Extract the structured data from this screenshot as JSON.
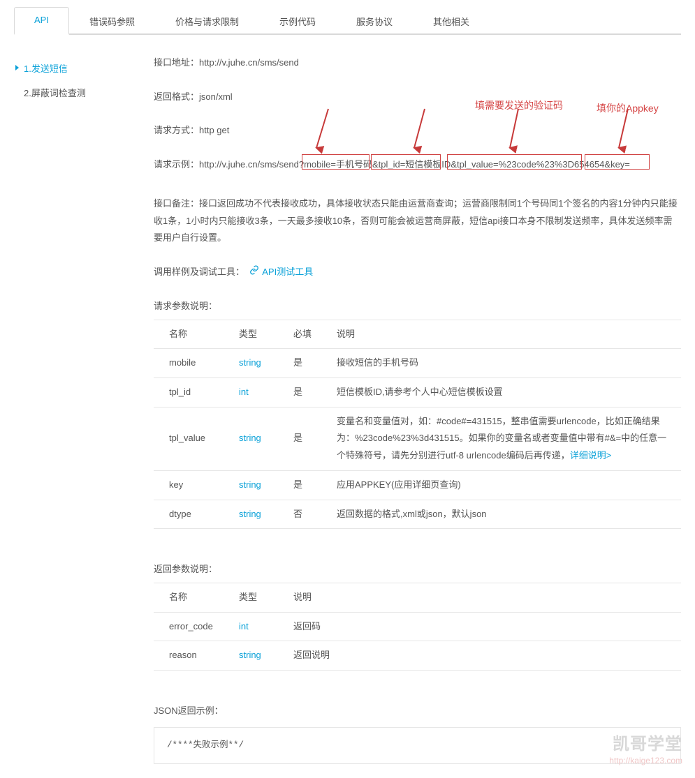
{
  "tabs": [
    "API",
    "错误码参照",
    "价格与请求限制",
    "示例代码",
    "服务协议",
    "其他相关"
  ],
  "sidebar": {
    "items": [
      {
        "label": "1.发送短信"
      },
      {
        "label": "2.屏蔽词检查测"
      }
    ]
  },
  "fields": {
    "addr_label": "接口地址：",
    "addr_value": "http://v.juhe.cn/sms/send",
    "ret_label": "返回格式：",
    "ret_value": "json/xml",
    "method_label": "请求方式：",
    "method_value": "http get",
    "example_label": "请求示例：",
    "example_prefix": "http://v.juhe.cn/sms/send?",
    "example_p1": "mobile=手机号码",
    "example_amp1": "&",
    "example_p2": "tpl_id=短信模板ID",
    "example_amp2": "&",
    "example_p3": "tpl_value=%23code%23%3D654654",
    "example_amp3": "&",
    "example_p4": "key=",
    "remark_label": "接口备注：",
    "remark_value": "接口返回成功不代表接收成功，具体接收状态只能由运营商查询；运营商限制同1个号码同1个签名的内容1分钟内只能接收1条，1小时内只能接收3条，一天最多接收10条，否则可能会被运营商屏蔽，短信api接口本身不限制发送频率，具体发送频率需要用户自行设置。",
    "debug_label": "调用样例及调试工具：",
    "debug_link": "API测试工具",
    "req_params_label": "请求参数说明：",
    "resp_params_label": "返回参数说明：",
    "json_example_label": "JSON返回示例：",
    "code_block": "/****失败示例**/"
  },
  "hints": {
    "h1": "填需要发送的验证码",
    "h2": "填你的Appkey"
  },
  "req_table": {
    "headers": [
      "名称",
      "类型",
      "必填",
      "说明"
    ],
    "rows": [
      {
        "name": "mobile",
        "type": "string",
        "req": "是",
        "desc": "接收短信的手机号码"
      },
      {
        "name": "tpl_id",
        "type": "int",
        "req": "是",
        "desc": "短信模板ID,请参考个人中心短信模板设置"
      },
      {
        "name": "tpl_value",
        "type": "string",
        "req": "是",
        "desc": "变量名和变量值对，如：#code#=431515，整串值需要urlencode，比如正确结果为：%23code%23%3d431515。如果你的变量名或者变量值中带有#&=中的任意一个特殊符号，请先分别进行utf-8 urlencode编码后再传递，",
        "link": "详细说明>"
      },
      {
        "name": "key",
        "type": "string",
        "req": "是",
        "desc": "应用APPKEY(应用详细页查询)"
      },
      {
        "name": "dtype",
        "type": "string",
        "req": "否",
        "desc": "返回数据的格式,xml或json，默认json"
      }
    ]
  },
  "resp_table": {
    "headers": [
      "名称",
      "类型",
      "说明"
    ],
    "rows": [
      {
        "name": "error_code",
        "type": "int",
        "desc": "返回码"
      },
      {
        "name": "reason",
        "type": "string",
        "desc": "返回说明"
      }
    ]
  },
  "watermark": {
    "main": "凯哥学堂",
    "sub": "http://kaige123.com"
  }
}
